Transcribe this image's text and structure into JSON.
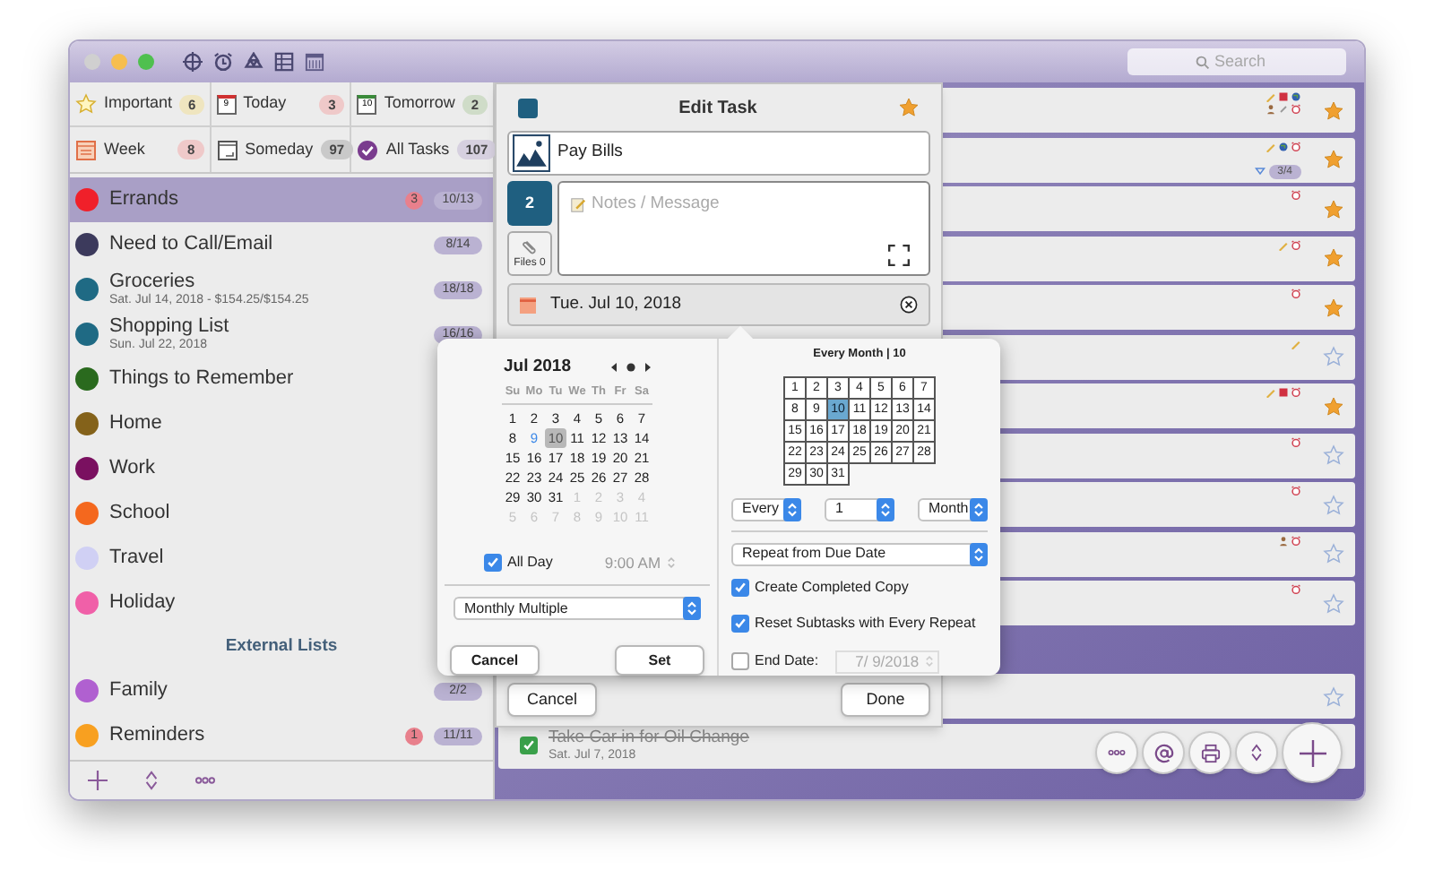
{
  "search": {
    "placeholder": "Search"
  },
  "filters": [
    {
      "label": "Important",
      "count": "6",
      "kind": "star",
      "color": "#efe5bf"
    },
    {
      "label": "Today",
      "count": "3",
      "kind": "day",
      "day": "9",
      "color": "#efc9c9"
    },
    {
      "label": "Tomorrow",
      "count": "2",
      "kind": "day",
      "day": "10",
      "color": "#cfdcc8"
    },
    {
      "label": "Week",
      "count": "8",
      "kind": "week",
      "color": "#efc9c9"
    },
    {
      "label": "Someday",
      "count": "97",
      "kind": "someday",
      "color": "#c9c9c9"
    },
    {
      "label": "All Tasks",
      "count": "107",
      "kind": "all",
      "color": "#d6d0df"
    }
  ],
  "lists": [
    {
      "name": "Errands",
      "color": "#f0202a",
      "selected": true,
      "alert": "3",
      "count": "10/13"
    },
    {
      "name": "Need to Call/Email",
      "color": "#3c3a5c",
      "selected": false,
      "count": "8/14"
    },
    {
      "name": "Groceries",
      "subtitle": "Sat. Jul 14, 2018 - $154.25/$154.25",
      "color": "#1f6a84",
      "selected": false,
      "count": "18/18"
    },
    {
      "name": "Shopping List",
      "subtitle": "Sun. Jul 22, 2018",
      "color": "#1f6a84",
      "selected": false,
      "count": "16/16"
    },
    {
      "name": "Things to Remember",
      "color": "#2a6a1e",
      "selected": false
    },
    {
      "name": "Home",
      "color": "#84621a",
      "selected": false
    },
    {
      "name": "Work",
      "color": "#7a1060",
      "selected": false
    },
    {
      "name": "School",
      "color": "#f4681e",
      "selected": false
    },
    {
      "name": "Travel",
      "color": "#d0d0f4",
      "selected": false
    },
    {
      "name": "Holiday",
      "color": "#f060a8",
      "selected": false
    }
  ],
  "external_header": "External Lists",
  "external_lists": [
    {
      "name": "Family",
      "color": "#b060d0",
      "selected": false,
      "count": "2/2"
    },
    {
      "name": "Reminders",
      "color": "#f8a020",
      "selected": false,
      "alert": "1",
      "count": "11/11"
    }
  ],
  "tasks": [
    {
      "starred": true,
      "indicators": [
        {
          "kind": "pencil"
        },
        {
          "kind": "calendar"
        },
        {
          "kind": "globe"
        },
        {
          "kind": "person"
        },
        {
          "kind": "clip"
        },
        {
          "kind": "alarm"
        }
      ]
    },
    {
      "starred": true,
      "indicators": [
        {
          "kind": "pencil"
        },
        {
          "kind": "globe"
        },
        {
          "kind": "alarm"
        }
      ],
      "subtasks": "3/4"
    },
    {
      "starred": true,
      "indicators": [
        {
          "kind": "alarm"
        }
      ]
    },
    {
      "starred": true,
      "indicators": [
        {
          "kind": "pencil"
        },
        {
          "kind": "alarm"
        }
      ]
    },
    {
      "starred": true,
      "indicators": [
        {
          "kind": "alarm"
        }
      ]
    },
    {
      "starred": false,
      "indicators": [
        {
          "kind": "pencil"
        }
      ]
    },
    {
      "starred": true,
      "indicators": [
        {
          "kind": "pencil"
        },
        {
          "kind": "calendar"
        },
        {
          "kind": "alarm"
        }
      ]
    },
    {
      "starred": false,
      "indicators": [
        {
          "kind": "alarm"
        }
      ]
    },
    {
      "starred": false,
      "indicators": [
        {
          "kind": "alarm"
        }
      ]
    },
    {
      "starred": false,
      "indicators": [
        {
          "kind": "person"
        },
        {
          "kind": "alarm"
        }
      ]
    },
    {
      "starred": false,
      "indicators": [
        {
          "kind": "alarm"
        }
      ]
    }
  ],
  "later_tasks": [
    {
      "starred": false
    },
    {
      "title": "Take Car in for Oil Change",
      "date": "Sat. Jul 7, 2018",
      "completed": true
    }
  ],
  "edit_task": {
    "title": "Edit Task",
    "color": "#1f5f80",
    "starred": true,
    "name": "Pay Bills",
    "priority": "2",
    "files": "Files 0",
    "notes_placeholder": "Notes / Message",
    "due": "Tue. Jul 10, 2018",
    "buttons": [
      "Cancel",
      "Done"
    ]
  },
  "date_picker": {
    "month": "Jul 2018",
    "weekdays": [
      "Su",
      "Mo",
      "Tu",
      "We",
      "Th",
      "Fr",
      "Sa"
    ],
    "days": [
      {
        "label": "1",
        "outside": false,
        "today": false,
        "selected": false
      },
      {
        "label": "2",
        "outside": false,
        "today": false,
        "selected": false
      },
      {
        "label": "3",
        "outside": false,
        "today": false,
        "selected": false
      },
      {
        "label": "4",
        "outside": false,
        "today": false,
        "selected": false
      },
      {
        "label": "5",
        "outside": false,
        "today": false,
        "selected": false
      },
      {
        "label": "6",
        "outside": false,
        "today": false,
        "selected": false
      },
      {
        "label": "7",
        "outside": false,
        "today": false,
        "selected": false
      },
      {
        "label": "8",
        "outside": false,
        "today": false,
        "selected": false
      },
      {
        "label": "9",
        "outside": false,
        "today": true,
        "selected": false
      },
      {
        "label": "10",
        "outside": false,
        "today": false,
        "selected": true
      },
      {
        "label": "11",
        "outside": false,
        "today": false,
        "selected": false
      },
      {
        "label": "12",
        "outside": false,
        "today": false,
        "selected": false
      },
      {
        "label": "13",
        "outside": false,
        "today": false,
        "selected": false
      },
      {
        "label": "14",
        "outside": false,
        "today": false,
        "selected": false
      },
      {
        "label": "15",
        "outside": false,
        "today": false,
        "selected": false
      },
      {
        "label": "16",
        "outside": false,
        "today": false,
        "selected": false
      },
      {
        "label": "17",
        "outside": false,
        "today": false,
        "selected": false
      },
      {
        "label": "18",
        "outside": false,
        "today": false,
        "selected": false
      },
      {
        "label": "19",
        "outside": false,
        "today": false,
        "selected": false
      },
      {
        "label": "20",
        "outside": false,
        "today": false,
        "selected": false
      },
      {
        "label": "21",
        "outside": false,
        "today": false,
        "selected": false
      },
      {
        "label": "22",
        "outside": false,
        "today": false,
        "selected": false
      },
      {
        "label": "23",
        "outside": false,
        "today": false,
        "selected": false
      },
      {
        "label": "24",
        "outside": false,
        "today": false,
        "selected": false
      },
      {
        "label": "25",
        "outside": false,
        "today": false,
        "selected": false
      },
      {
        "label": "26",
        "outside": false,
        "today": false,
        "selected": false
      },
      {
        "label": "27",
        "outside": false,
        "today": false,
        "selected": false
      },
      {
        "label": "28",
        "outside": false,
        "today": false,
        "selected": false
      },
      {
        "label": "29",
        "outside": false,
        "today": false,
        "selected": false
      },
      {
        "label": "30",
        "outside": false,
        "today": false,
        "selected": false
      },
      {
        "label": "31",
        "outside": false,
        "today": false,
        "selected": false
      },
      {
        "label": "1",
        "outside": true,
        "today": false,
        "selected": false
      },
      {
        "label": "2",
        "outside": true,
        "today": false,
        "selected": false
      },
      {
        "label": "3",
        "outside": true,
        "today": false,
        "selected": false
      },
      {
        "label": "4",
        "outside": true,
        "today": false,
        "selected": false
      },
      {
        "label": "5",
        "outside": true,
        "today": false,
        "selected": false
      },
      {
        "label": "6",
        "outside": true,
        "today": false,
        "selected": false
      },
      {
        "label": "7",
        "outside": true,
        "today": false,
        "selected": false
      },
      {
        "label": "8",
        "outside": true,
        "today": false,
        "selected": false
      },
      {
        "label": "9",
        "outside": true,
        "today": false,
        "selected": false
      },
      {
        "label": "10",
        "outside": true,
        "today": false,
        "selected": false
      },
      {
        "label": "11",
        "outside": true,
        "today": false,
        "selected": false
      }
    ],
    "all_day": {
      "label": "All Day",
      "checked": true
    },
    "time": "9:00 AM",
    "repeat_type": "Monthly Multiple",
    "buttons": [
      "Cancel",
      "Set"
    ]
  },
  "repeat": {
    "summary": "Every Month | 10",
    "days": [
      {
        "label": "1",
        "selected": false
      },
      {
        "label": "2",
        "selected": false
      },
      {
        "label": "3",
        "selected": false
      },
      {
        "label": "4",
        "selected": false
      },
      {
        "label": "5",
        "selected": false
      },
      {
        "label": "6",
        "selected": false
      },
      {
        "label": "7",
        "selected": false
      },
      {
        "label": "8",
        "selected": false
      },
      {
        "label": "9",
        "selected": false
      },
      {
        "label": "10",
        "selected": true
      },
      {
        "label": "11",
        "selected": false
      },
      {
        "label": "12",
        "selected": false
      },
      {
        "label": "13",
        "selected": false
      },
      {
        "label": "14",
        "selected": false
      },
      {
        "label": "15",
        "selected": false
      },
      {
        "label": "16",
        "selected": false
      },
      {
        "label": "17",
        "selected": false
      },
      {
        "label": "18",
        "selected": false
      },
      {
        "label": "19",
        "selected": false
      },
      {
        "label": "20",
        "selected": false
      },
      {
        "label": "21",
        "selected": false
      },
      {
        "label": "22",
        "selected": false
      },
      {
        "label": "23",
        "selected": false
      },
      {
        "label": "24",
        "selected": false
      },
      {
        "label": "25",
        "selected": false
      },
      {
        "label": "26",
        "selected": false
      },
      {
        "label": "27",
        "selected": false
      },
      {
        "label": "28",
        "selected": false
      },
      {
        "label": "29",
        "selected": false
      },
      {
        "label": "30",
        "selected": false
      },
      {
        "label": "31",
        "selected": false
      }
    ],
    "every": "Every",
    "interval": "1",
    "unit": "Month",
    "repeat_from": "Repeat from Due Date",
    "options": [
      {
        "label": "Create Completed Copy",
        "checked": true
      },
      {
        "label": "Reset Subtasks with Every Repeat",
        "checked": true
      }
    ],
    "end_date": {
      "label": "End Date:",
      "checked": false,
      "value": "7/ 9/2018"
    }
  }
}
